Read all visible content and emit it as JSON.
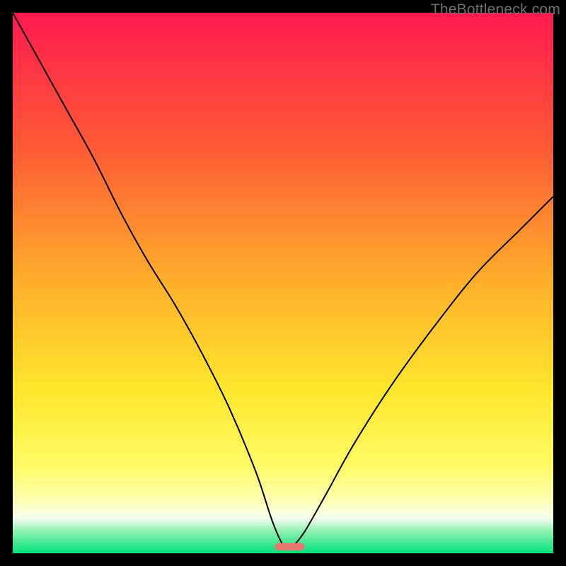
{
  "watermark": "TheBottleneck.com",
  "colors": {
    "frame": "#000000",
    "curve": "#000000",
    "gradient_stops": [
      {
        "offset": 0.0,
        "color": "#ff1a4f"
      },
      {
        "offset": 0.25,
        "color": "#ff5a36"
      },
      {
        "offset": 0.5,
        "color": "#ffb02b"
      },
      {
        "offset": 0.7,
        "color": "#ffe72c"
      },
      {
        "offset": 0.84,
        "color": "#fffb67"
      },
      {
        "offset": 0.9,
        "color": "#ffffb0"
      },
      {
        "offset": 0.935,
        "color": "#f7ffef"
      },
      {
        "offset": 0.96,
        "color": "#8cf0b0"
      },
      {
        "offset": 1.0,
        "color": "#00e27a"
      }
    ],
    "marker": "#e8786e"
  },
  "chart_data": {
    "type": "line",
    "title": "",
    "xlabel": "",
    "ylabel": "",
    "xlim": [
      0,
      100
    ],
    "ylim": [
      0,
      100
    ],
    "grid": false,
    "legend": false,
    "optimum_x": 51,
    "marker": {
      "x_start": 48.5,
      "x_end": 54,
      "y": 1.2
    },
    "series": [
      {
        "name": "bottleneck-curve",
        "x": [
          0,
          5,
          10,
          15,
          20,
          25,
          30,
          35,
          40,
          45,
          48,
          50,
          51,
          52,
          54,
          58,
          63,
          70,
          78,
          86,
          94,
          100
        ],
        "y": [
          100,
          91,
          82,
          73,
          63,
          54,
          46,
          37,
          27,
          15,
          6,
          1.5,
          1,
          1.5,
          4,
          11,
          20,
          31,
          42,
          52,
          60,
          66
        ]
      }
    ]
  }
}
